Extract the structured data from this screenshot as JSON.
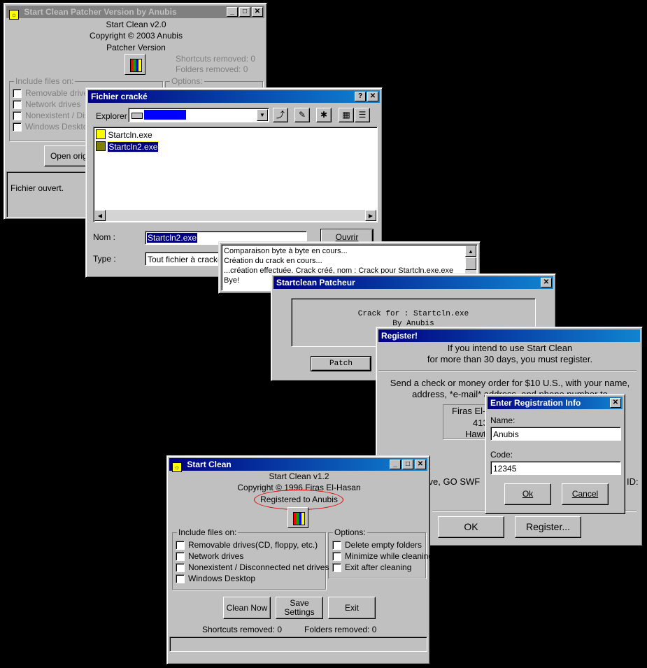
{
  "patcher": {
    "title": "Start Clean Patcher Version by Anubis",
    "line1": "Start Clean v2.0",
    "line2": "Copyright © 2003 Anubis",
    "line3": "Patcher Version",
    "shortcuts": "Shortcuts removed: 0",
    "folders": "Folders removed: 0",
    "include_label": "Include files on:",
    "options_label": "Options:",
    "checks": [
      "Removable drives",
      "Network drives",
      "Nonexistent / Disc",
      "Windows Desktop"
    ],
    "open_button": "Open origin",
    "status": "Fichier ouvert."
  },
  "file_dialog": {
    "title": "Fichier cracké",
    "explorer_label": "Explorer :",
    "files": [
      "Startcln.exe",
      "Startcln2.exe"
    ],
    "name_label": "Nom :",
    "name_value": "Startcln2.exe",
    "type_label": "Type :",
    "type_value": "Tout fichier à cracker",
    "open_button": "Ouvrir"
  },
  "log": {
    "lines": [
      "Comparaison byte à byte en cours...",
      "Création du crack en cours...",
      "...création effectuée. Crack créé, nom : Crack  pour  Startcln.exe.exe",
      "Bye!"
    ]
  },
  "patcheur": {
    "title": "Startclean Patcheur",
    "line1": "Crack for : Startcln.exe",
    "line2": "By Anubis",
    "patch_button": "Patch"
  },
  "register": {
    "title": "Register!",
    "text1": "If you intend to use Start Clean",
    "text2": "for more than 30 days, you must register.",
    "text3": "Send a check or money order for $10 U.S., with your name,",
    "text4": "address, *e-mail* address, and phone number to",
    "addr1": "Firas El-",
    "addr2": "413",
    "addr3": "Hawt",
    "text5": "erve, GO SWF",
    "text6": "ID:",
    "ok_button": "OK",
    "register_button": "Register..."
  },
  "reginfo": {
    "title": "Enter Registration Info",
    "name_label": "Name:",
    "name_value": "Anubis",
    "code_label": "Code:",
    "code_value": "12345",
    "ok_button": "Ok",
    "cancel_button": "Cancel"
  },
  "startclean": {
    "title": "Start Clean",
    "line1": "Start Clean v1.2",
    "line2": "Copyright © 1996 Firas El-Hasan",
    "line3": "Registered to Anubis",
    "include_label": "Include files on:",
    "checks": [
      "Removable drives(CD, floppy, etc.)",
      "Network drives",
      "Nonexistent / Disconnected net drives",
      "Windows Desktop"
    ],
    "options_label": "Options:",
    "options": [
      "Delete empty folders",
      "Minimize while cleaning",
      "Exit after cleaning"
    ],
    "clean_button": "Clean Now",
    "save_button_1": "Save",
    "save_button_2": "Settings",
    "exit_button": "Exit",
    "shortcuts": "Shortcuts removed:  0",
    "folders": "Folders removed:  0"
  },
  "colors": {
    "highlight": "#000080",
    "circle": "#e00000"
  }
}
